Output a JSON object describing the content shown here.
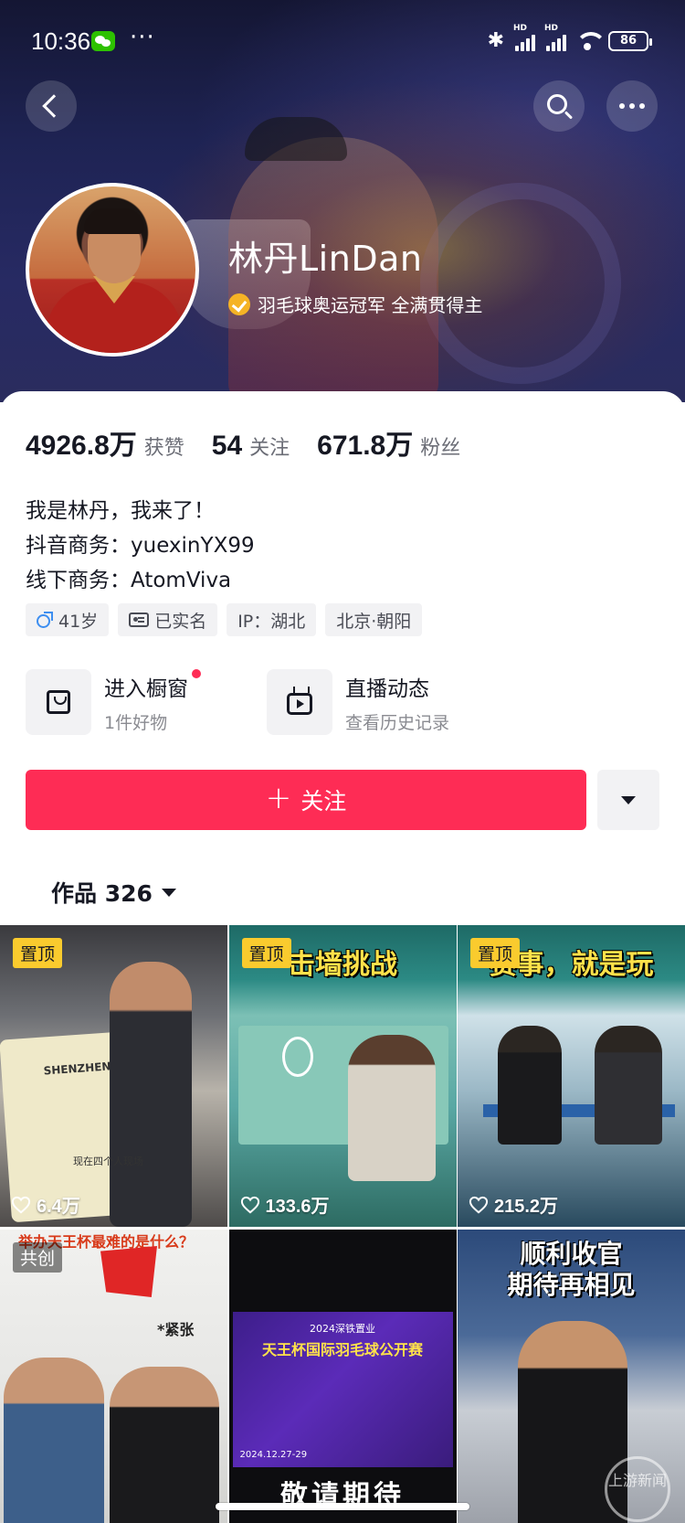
{
  "status_bar": {
    "time": "10:36",
    "battery": "86",
    "more": "···"
  },
  "profile": {
    "name": "林丹LinDan",
    "verification": "羽毛球奥运冠军 全满贯得主"
  },
  "stats": [
    {
      "value": "4926.8万",
      "label": "获赞"
    },
    {
      "value": "54",
      "label": "关注"
    },
    {
      "value": "671.8万",
      "label": "粉丝"
    }
  ],
  "bio": {
    "line1": "我是林丹，我来了！",
    "line2": "抖音商务：yuexinYX99",
    "line3": "线下商务：AtomViva"
  },
  "tags": {
    "age": "41岁",
    "realname": "已实名",
    "ip": "IP：湖北",
    "location": "北京·朝阳"
  },
  "entries": {
    "shop_title": "进入橱窗",
    "shop_sub": "1件好物",
    "live_title": "直播动态",
    "live_sub": "查看历史记录"
  },
  "actions": {
    "follow_label": "关注"
  },
  "works": {
    "label": "作品 326"
  },
  "videos": [
    {
      "badge": "置顶",
      "likes": "6.4万",
      "caption": "现在四个人现场",
      "shirt_text": "SHENZHEN"
    },
    {
      "badge": "置顶",
      "likes": "133.6万",
      "headline": "击墙挑战"
    },
    {
      "badge": "置顶",
      "likes": "215.2万",
      "headline": "赛事，就是玩"
    },
    {
      "badge": "共创",
      "topline": "举办天王杯最难的是什么？",
      "side": "*紧张"
    },
    {
      "poster_top": "2024深铁置业",
      "poster_title": "天王杯国际羽毛球公开赛",
      "poster_date": "2024.12.27-29",
      "bottom": "敬请期待"
    },
    {
      "headline": "顺利收官\n期待再相见",
      "watermark": "上游新闻"
    }
  ],
  "colors": {
    "accent": "#fe2c55",
    "pin": "#facb2e",
    "verify": "#f5b325"
  }
}
